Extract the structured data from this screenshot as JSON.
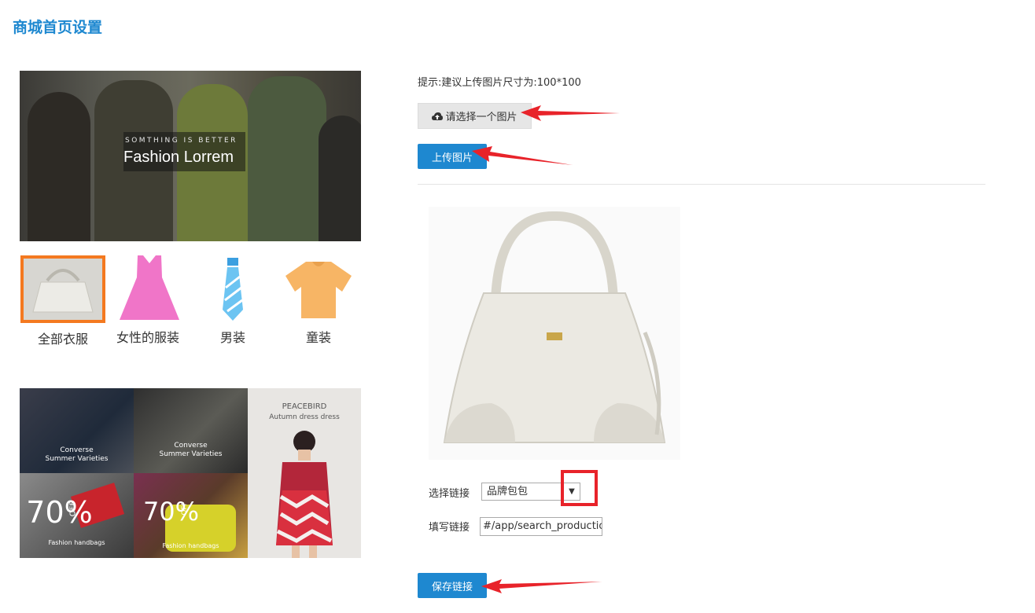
{
  "page": {
    "title": "商城首页设置"
  },
  "banner": {
    "small_text": "SOMTHING IS BETTER",
    "big_text": "Fashion Lorrem"
  },
  "categories": [
    {
      "label": "全部衣服",
      "icon": "handbag-icon",
      "selected": true
    },
    {
      "label": "女性的服装",
      "icon": "dress-icon",
      "selected": false
    },
    {
      "label": "男装",
      "icon": "tie-icon",
      "selected": false
    },
    {
      "label": "童装",
      "icon": "tshirt-icon",
      "selected": false
    }
  ],
  "promo": {
    "tile1": {
      "line1": "Converse",
      "line2": "Summer Varieties"
    },
    "tile2": {
      "line1": "Converse",
      "line2": "Summer Varieties"
    },
    "tile3": {
      "line1": "PEACEBIRD",
      "line2": "Autumn dress dress"
    },
    "tile4": {
      "big": "70%",
      "off": "OFF",
      "caption": "Fashion handbags"
    },
    "tile5": {
      "big": "70%",
      "off": "OFF",
      "caption": "Fashion handbags"
    }
  },
  "upload": {
    "hint": "提示:建议上传图片尺寸为:100*100",
    "choose_label": "请选择一个图片",
    "upload_label": "上传图片"
  },
  "link": {
    "select_label": "选择链接",
    "select_value": "品牌包包",
    "input_label": "填写链接",
    "input_value": "#/app/search_productio",
    "save_label": "保存链接"
  },
  "colors": {
    "accent": "#1e88d0",
    "highlight_orange": "#f47920",
    "annotation_red": "#e8232a"
  }
}
